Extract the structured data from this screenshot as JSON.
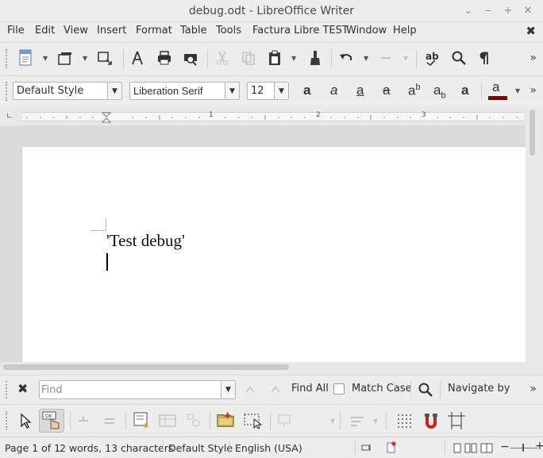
{
  "window": {
    "title": "debug.odt - LibreOffice Writer",
    "controls": {
      "shade": "⌄",
      "minimize": "‒",
      "maximize": "+",
      "close": "✕"
    }
  },
  "menubar": {
    "items": [
      "File",
      "Edit",
      "View",
      "Insert",
      "Format",
      "Table",
      "Tools",
      "Factura Libre TEST",
      "Window",
      "Help"
    ],
    "close_doc": "✖"
  },
  "toolbar_standard": {
    "icons": [
      "new-document-icon",
      "templates-icon",
      "export-icon",
      "export-pdf-icon",
      "print-icon",
      "print-preview-icon",
      "cut-icon",
      "copy-icon",
      "paste-icon",
      "clone-formatting-icon",
      "undo-icon",
      "redo-icon",
      "spelling-icon",
      "find-replace-icon",
      "formatting-marks-icon"
    ],
    "disabled": [
      "cut-icon",
      "copy-icon",
      "redo-icon"
    ],
    "overflow": "»"
  },
  "toolbar_formatting": {
    "paragraph_style": "Default Style",
    "font_name": "Liberation Serif",
    "font_size": "12",
    "buttons": {
      "bold": "a",
      "italic": "a",
      "underline": "a",
      "strikethrough": "a",
      "superscript_base": "a",
      "superscript_mark": "b",
      "subscript_base": "a",
      "subscript_mark": "b",
      "shadow": "a",
      "font_color": "a"
    },
    "font_color_swatch": "#8b0000",
    "overflow": "»"
  },
  "ruler": {
    "numbers": [
      "1",
      "2",
      "3"
    ]
  },
  "document": {
    "lines": [
      "'Test debug'"
    ]
  },
  "find_toolbar": {
    "close": "✖",
    "placeholder": "Find",
    "find_all": "Find All",
    "match_case": "Match Case",
    "match_case_checked": false,
    "navigate_by": "Navigate by",
    "overflow": "»"
  },
  "toolbar_drawing": {
    "icons": [
      "select-icon",
      "form-design-mode-icon",
      "control-properties-icon",
      "form-properties-icon",
      "form-wizard-icon",
      "table-control-icon",
      "activation-order-icon",
      "add-field-icon",
      "form-navigator-icon",
      "group-icon",
      "align-icon",
      "grid-icon",
      "snap-icon",
      "helplines-icon"
    ]
  },
  "statusbar": {
    "page": "Page 1 of 1",
    "words": "2 words, 13 characters",
    "style": "Default Style",
    "language": "English (USA)",
    "zoom_minus": "−",
    "zoom_plus": "+"
  },
  "colors": {
    "accent_font_color": "#8b0000",
    "page_bg": "#ffffff",
    "chrome_bg": "#ededeb"
  }
}
